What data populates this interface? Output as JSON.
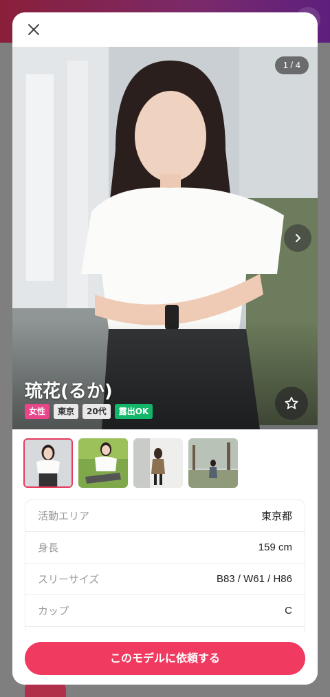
{
  "modal": {
    "close_icon": "close-icon",
    "photo_counter": "1 / 4",
    "model_name": "琉花(るか)",
    "tags": {
      "gender": "女性",
      "area": "東京",
      "age": "20代",
      "exposure": "露出OK"
    },
    "next_icon": "chevron-right-icon",
    "favorite_icon": "star-icon",
    "thumbnails": [
      "photo-1",
      "photo-2",
      "photo-3",
      "photo-4"
    ],
    "specs": [
      {
        "label": "活動エリア",
        "value": "東京都"
      },
      {
        "label": "身長",
        "value": "159 cm"
      },
      {
        "label": "スリーサイズ",
        "value": "B83 / W61 / H86"
      },
      {
        "label": "カップ",
        "value": "C"
      }
    ],
    "cta_label": "このモデルに依頼する"
  },
  "colors": {
    "accent": "#f03a5f",
    "tag_gender": "#e8458a",
    "tag_ok": "#12b76a"
  }
}
